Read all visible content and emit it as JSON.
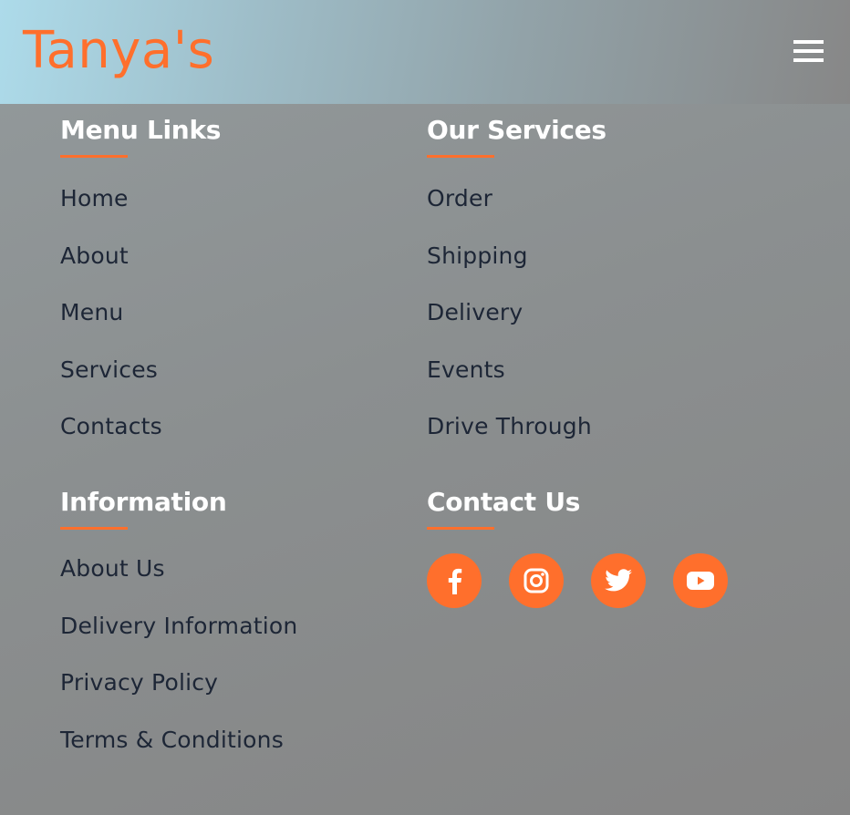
{
  "header": {
    "logo": "Tanya's"
  },
  "footer": {
    "menu_links": {
      "heading": "Menu Links",
      "items": [
        "Home",
        "About",
        "Menu",
        "Services",
        "Contacts"
      ]
    },
    "our_services": {
      "heading": "Our Services",
      "items": [
        "Order",
        "Shipping",
        "Delivery",
        "Events",
        "Drive Through"
      ]
    },
    "information": {
      "heading": "Information",
      "items": [
        "About Us",
        "Delivery Information",
        "Privacy Policy",
        "Terms & Conditions"
      ]
    },
    "contact_us": {
      "heading": "Contact Us",
      "socials": [
        "facebook-icon",
        "instagram-icon",
        "twitter-icon",
        "youtube-icon"
      ]
    }
  },
  "colors": {
    "accent": "#ff6f2c",
    "link_text": "#1d2636",
    "heading_text": "#ffffff"
  }
}
